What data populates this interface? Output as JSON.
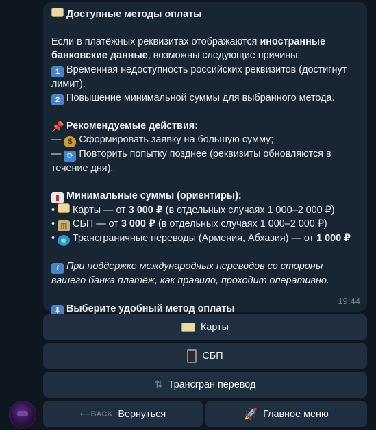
{
  "message": {
    "title": "Доступные методы оплаты",
    "intro_1": "Если в платёжных реквизитах отображаются ",
    "intro_bold": "иностранные банковские данные",
    "intro_2": ", возможны следующие причины:",
    "reasons": [
      {
        "num": "1",
        "text": "Временная недоступность российских реквизитов (достигнут лимит)."
      },
      {
        "num": "2",
        "text": "Повышение минимальной суммы для выбранного метода."
      }
    ],
    "actions_title": "Рекомендуемые действия:",
    "actions": [
      {
        "prefix": "—",
        "text": "Сформировать заявку на большую сумму;"
      },
      {
        "prefix": "—",
        "text": "Повторить попытку позднее (реквизиты обновляются в течение дня)."
      }
    ],
    "minimums_title": "Минимальные суммы (ориентиры):",
    "minimums": [
      {
        "bullet": "•",
        "a": "Карты — от ",
        "amount": "3 000 ₽",
        "b": " (в отдельных случаях 1 000–2 000 ₽)"
      },
      {
        "bullet": "•",
        "a": "СБП — от ",
        "amount": "3 000 ₽",
        "b": " (в отдельных случаях 1 000–2 000 ₽)"
      },
      {
        "bullet": "•",
        "a": "Трансграничные переводы (Армения, Абхазия) — от ",
        "amount": "1 000 ₽",
        "b": ""
      }
    ],
    "note": "При поддержке международных переводов со стороны вашего банка платёж, как правило, проходит оперативно.",
    "choose": "Выберите удобный метод оплаты",
    "time": "19:44"
  },
  "keyboard": {
    "cards": "Карты",
    "sbp": "СБП",
    "transgran": "Трансгран перевод",
    "back": "Вернуться",
    "back_icon_text": "BACK",
    "main_menu": "Главное меню"
  },
  "icons": {
    "title": "credit-card-icon",
    "actions_title": "pushpin-icon",
    "minimums_title": "bar-chart-icon",
    "note": "information-icon",
    "choose": "down-arrow-icon"
  }
}
